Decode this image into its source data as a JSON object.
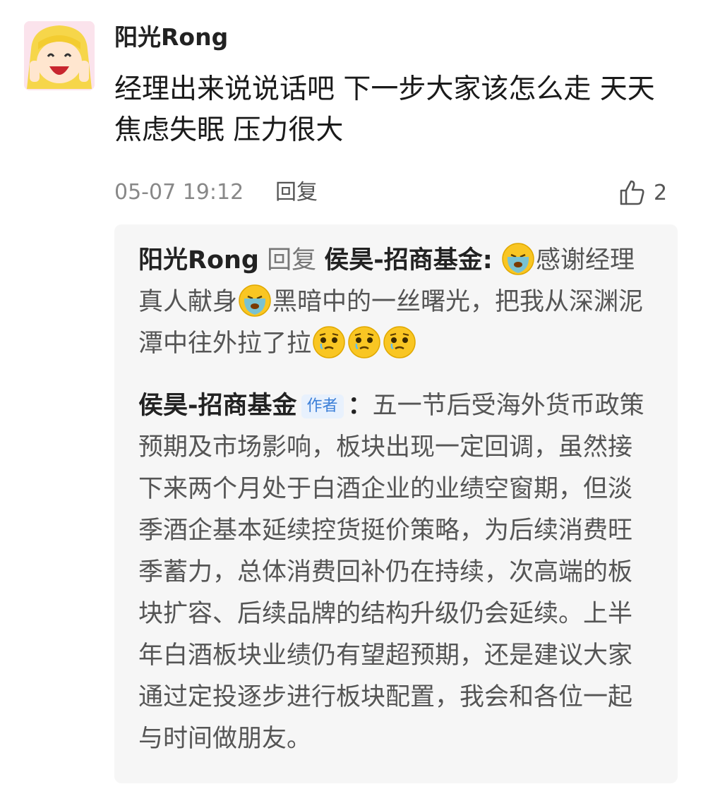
{
  "comment": {
    "username": "阳光Rong",
    "text": "经理出来说说话吧 下一步大家该怎么走 天天焦虑失眠 压力很大",
    "time": "05-07 19:12",
    "reply_label": "回复",
    "like_count": "2",
    "icons": {
      "avatar": "cartoon-girl-avatar",
      "like": "thumbs-up-outline-icon"
    }
  },
  "replies": {
    "user_reply": {
      "name": "阳光Rong",
      "verb": "回复",
      "target": "侯昊-招商基金:",
      "text_1": "感谢经理真人献身",
      "text_2": "黑暗中的一丝曙光，把我从深渊泥潭中往外拉了拉",
      "emojis": [
        "crying-emoji",
        "crying-emoji",
        "pleading-emoji",
        "pleading-emoji",
        "pleading-emoji"
      ]
    },
    "author_reply": {
      "name": "侯昊-招商基金",
      "tag": "作者",
      "separator": "：",
      "text": "五一节后受海外货币政策预期及市场影响，板块出现一定回调，虽然接下来两个月处于白酒企业的业绩空窗期，但淡季酒企基本延续控货挺价策略，为后续消费旺季蓄力，总体消费回补仍在持续，次高端的板块扩容、后续品牌的结构升级仍会延续。上半年白酒板块业绩仍有望超预期，还是建议大家通过定投逐步进行板块配置，我会和各位一起与时间做朋友。"
    }
  },
  "colors": {
    "author_tag": "#3b7fd8",
    "reply_bg": "#f6f6f6",
    "meta_text": "#888888"
  }
}
